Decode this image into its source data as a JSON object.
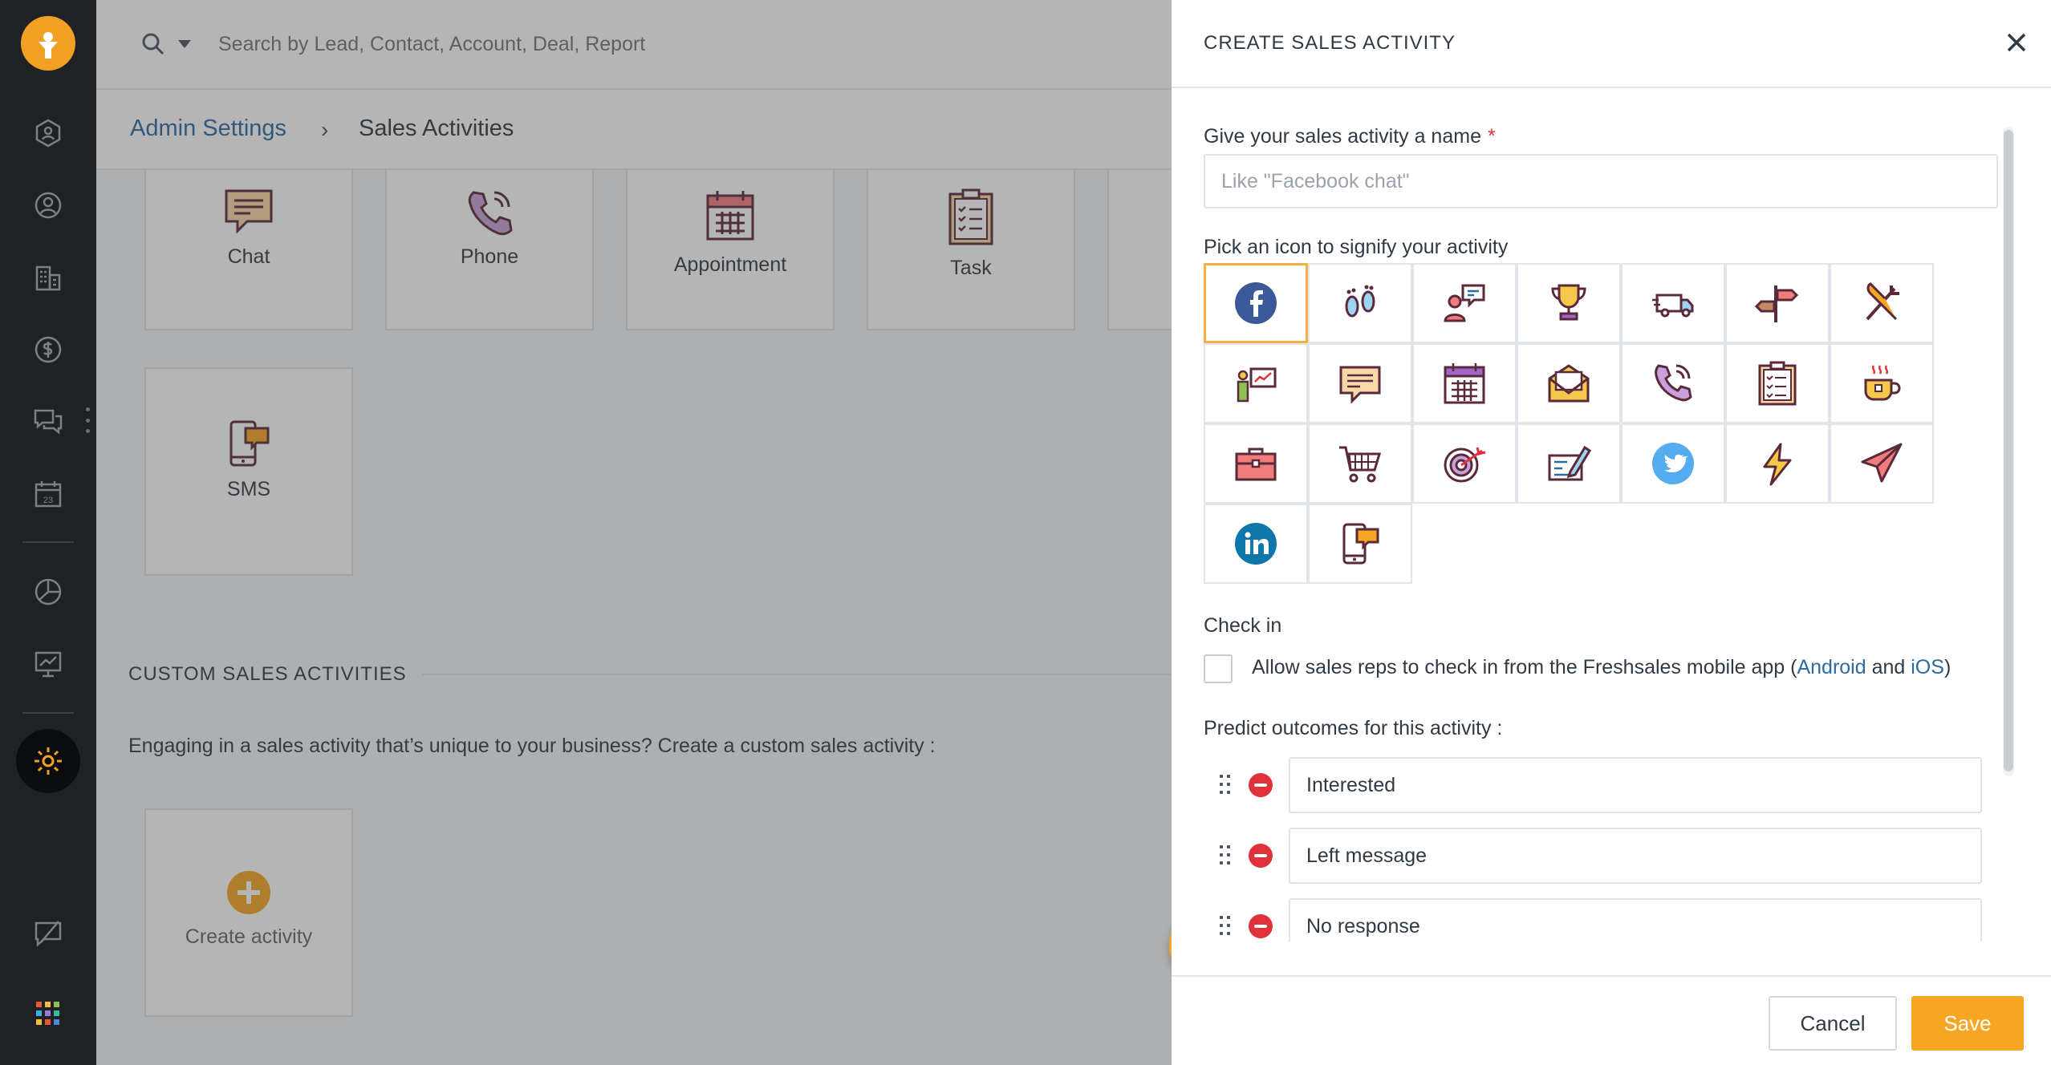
{
  "search": {
    "placeholder": "Search by Lead, Contact, Account, Deal, Report"
  },
  "breadcrumb": {
    "parent": "Admin Settings",
    "separator": "›",
    "current": "Sales Activities"
  },
  "activity_cards": [
    {
      "label": "Chat",
      "icon": "chat-icon"
    },
    {
      "label": "Phone",
      "icon": "phone-icon"
    },
    {
      "label": "Appointment",
      "icon": "calendar-icon"
    },
    {
      "label": "Task",
      "icon": "clipboard-icon"
    },
    {
      "label": "SMS",
      "icon": "mobile-sms-icon"
    }
  ],
  "custom_section": {
    "title": "CUSTOM SALES ACTIVITIES",
    "description": "Engaging in a sales activity that’s unique to your business? Create a custom sales activity :",
    "create_label": "Create activity"
  },
  "help": {
    "label": "?"
  },
  "drawer": {
    "title": "CREATE SALES ACTIVITY",
    "name_label": "Give your sales activity a name",
    "required_mark": "*",
    "name_placeholder": "Like \"Facebook chat\"",
    "icon_label": "Pick an icon to signify your activity",
    "icons": [
      "facebook-icon",
      "footprints-icon",
      "conversation-icon",
      "trophy-icon",
      "delivery-truck-icon",
      "signpost-icon",
      "fork-knife-icon",
      "presentation-icon",
      "chat-icon",
      "calendar-icon",
      "envelope-icon",
      "phone-icon",
      "clipboard-icon",
      "coffee-icon",
      "briefcase-icon",
      "shopping-cart-icon",
      "target-icon",
      "signature-icon",
      "twitter-icon",
      "lightning-icon",
      "paper-plane-icon",
      "linkedin-icon",
      "mobile-sms-icon"
    ],
    "selected_icon": "facebook-icon",
    "checkin_label": "Check in",
    "checkin_text_before": "Allow sales reps to check in from the Freshsales mobile app (",
    "checkin_android": "Android",
    "checkin_and": " and ",
    "checkin_ios": "iOS",
    "checkin_text_after": ")",
    "outcomes_label": "Predict outcomes for this activity :",
    "outcomes": [
      "Interested",
      "Left message",
      "No response"
    ],
    "cancel_label": "Cancel",
    "save_label": "Save"
  },
  "colors": {
    "accent": "#f6a623",
    "link": "#2c6aa0",
    "danger": "#e0323b",
    "rail": "#202124"
  }
}
